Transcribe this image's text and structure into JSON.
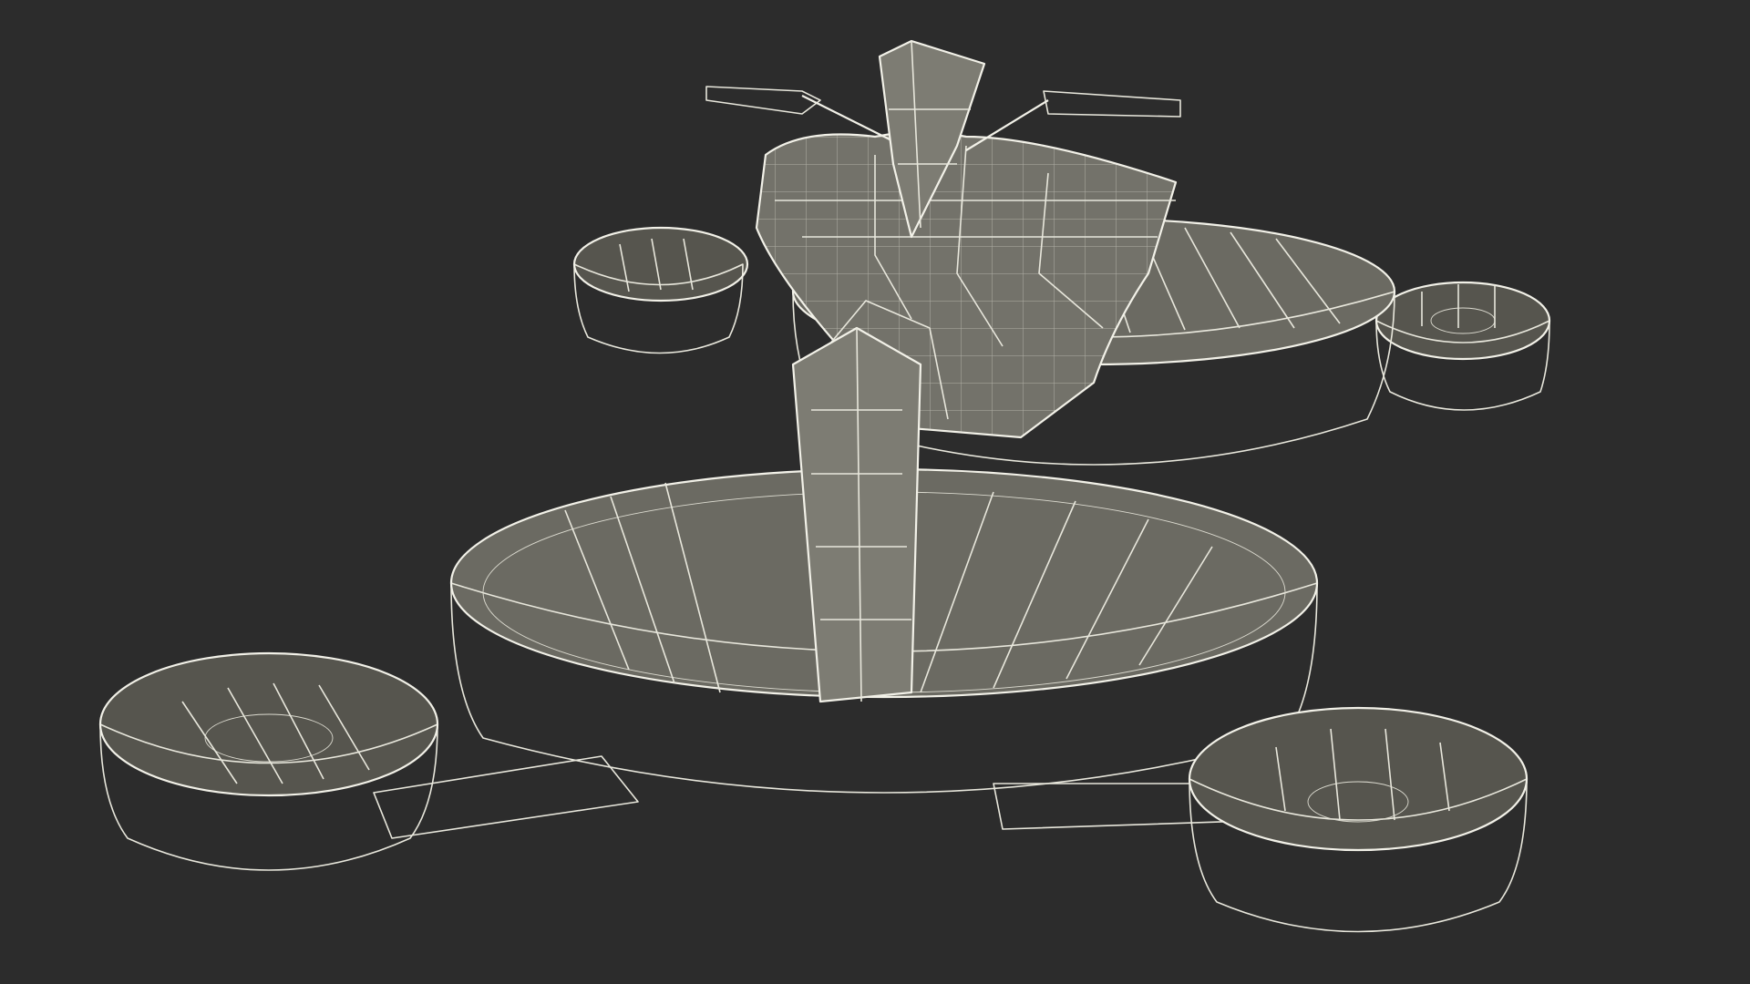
{
  "scene": {
    "background_color": "#2c2c2c",
    "mesh_color": "#6b6a62",
    "wire_color": "#e8e7dc",
    "subject": "hoverbike-wireframe-model"
  }
}
